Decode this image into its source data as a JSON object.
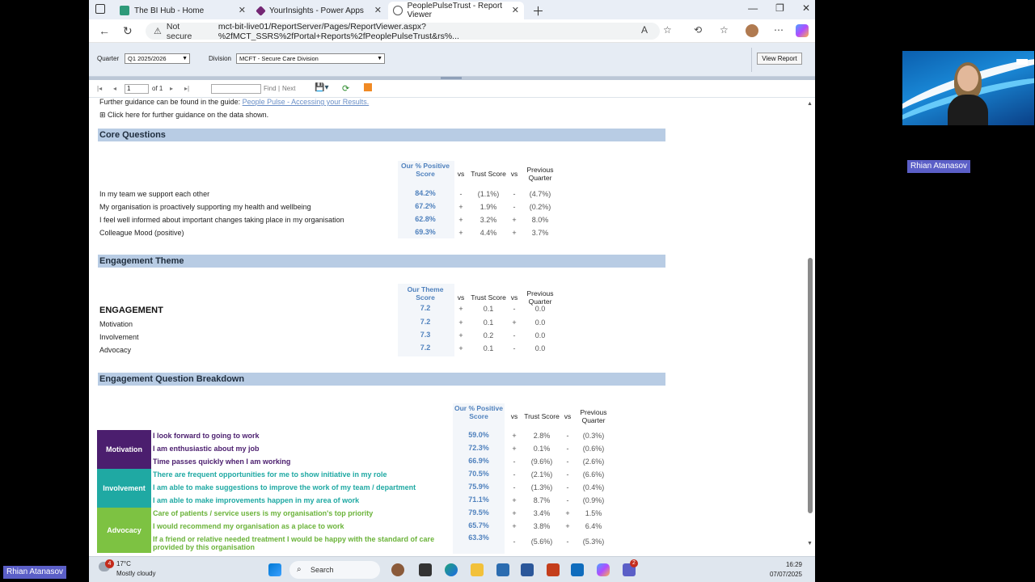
{
  "browser": {
    "tabs": [
      {
        "title": "The BI Hub - Home",
        "icon_color": "#2e9a7a"
      },
      {
        "title": "YourInsights - Power Apps",
        "icon_color": "#742774"
      },
      {
        "title": "PeoplePulseTrust - Report Viewer",
        "icon_color": "#666666"
      }
    ],
    "not_secure": "Not secure",
    "url": "mct-bit-live01/ReportServer/Pages/ReportViewer.aspx?%2fMCT_SSRS%2fPortal+Reports%2fPeoplePulseTrust&rs%..."
  },
  "params": {
    "quarter_label": "Quarter",
    "quarter_value": "Q1 2025/2026",
    "division_label": "Division",
    "division_value": "MCFT - Secure Care Division",
    "view_report": "View Report"
  },
  "toolbar": {
    "page": "1",
    "of": "of 1",
    "find": "Find",
    "sep": "|",
    "next": "Next"
  },
  "report": {
    "guidance_text": "Further guidance can be found in the guide:",
    "guidance_link": "People Pulse - Accessing your Results.",
    "expand_text": "⊞ Click here for further guidance on the data shown.",
    "core": {
      "title": "Core Questions",
      "hdr_score": "Our % Positive Score",
      "hdr_vs": "vs",
      "hdr_trust": "Trust Score",
      "hdr_prev": "Previous Quarter",
      "rows": [
        {
          "q": "In my team we support each other",
          "score": "84.2%",
          "s1": "-",
          "trust": "(1.1%)",
          "s2": "-",
          "prev": "(4.7%)"
        },
        {
          "q": "My organisation is proactively supporting my health and wellbeing",
          "score": "67.2%",
          "s1": "+",
          "trust": "1.9%",
          "s2": "-",
          "prev": "(0.2%)"
        },
        {
          "q": "I feel well informed about important changes taking place in my organisation",
          "score": "62.8%",
          "s1": "+",
          "trust": "3.2%",
          "s2": "+",
          "prev": "8.0%"
        },
        {
          "q": "Colleague Mood (positive)",
          "score": "69.3%",
          "s1": "+",
          "trust": "4.4%",
          "s2": "+",
          "prev": "3.7%"
        }
      ]
    },
    "engagement": {
      "title": "Engagement Theme",
      "hdr_score": "Our Theme Score",
      "hdr_vs": "vs",
      "hdr_trust": "Trust Score",
      "hdr_prev": "Previous Quarter",
      "rows": [
        {
          "q": "ENGAGEMENT",
          "score": "7.2",
          "s1": "+",
          "trust": "0.1",
          "s2": "-",
          "prev": "0.0",
          "bold": true
        },
        {
          "q": "Motivation",
          "score": "7.2",
          "s1": "+",
          "trust": "0.1",
          "s2": "+",
          "prev": "0.0"
        },
        {
          "q": "Involvement",
          "score": "7.3",
          "s1": "+",
          "trust": "0.2",
          "s2": "-",
          "prev": "0.0"
        },
        {
          "q": "Advocacy",
          "score": "7.2",
          "s1": "+",
          "trust": "0.1",
          "s2": "-",
          "prev": "0.0"
        }
      ]
    },
    "breakdown": {
      "title": "Engagement Question Breakdown",
      "hdr_score": "Our % Positive Score",
      "hdr_vs": "vs",
      "hdr_trust": "Trust Score",
      "hdr_prev": "Previous Quarter",
      "groups": [
        {
          "name": "Motivation",
          "color": "#4b1e6e",
          "text_color": "#4b1e6e",
          "rows": [
            {
              "q": "I look forward to going to work",
              "score": "59.0%",
              "s1": "+",
              "trust": "2.8%",
              "s2": "-",
              "prev": "(0.3%)"
            },
            {
              "q": "I am enthusiastic about my job",
              "score": "72.3%",
              "s1": "+",
              "trust": "0.1%",
              "s2": "-",
              "prev": "(0.6%)"
            },
            {
              "q": "Time passes quickly when I am working",
              "score": "66.9%",
              "s1": "-",
              "trust": "(9.6%)",
              "s2": "-",
              "prev": "(2.6%)"
            }
          ]
        },
        {
          "name": "Involvement",
          "color": "#1fa9a3",
          "text_color": "#1fa9a3",
          "rows": [
            {
              "q": "There are frequent opportunities for me to show initiative in my role",
              "score": "70.5%",
              "s1": "-",
              "trust": "(2.1%)",
              "s2": "-",
              "prev": "(6.6%)"
            },
            {
              "q": "I am able to make suggestions to improve the work of my team / department",
              "score": "75.9%",
              "s1": "-",
              "trust": "(1.3%)",
              "s2": "-",
              "prev": "(0.4%)"
            },
            {
              "q": "I am able to make improvements happen in my area of work",
              "score": "71.1%",
              "s1": "+",
              "trust": "8.7%",
              "s2": "-",
              "prev": "(0.9%)"
            }
          ]
        },
        {
          "name": "Advocacy",
          "color": "#7dc242",
          "text_color": "#6bb33a",
          "rows": [
            {
              "q": "Care of patients / service users is my organisation's top priority",
              "score": "79.5%",
              "s1": "+",
              "trust": "3.4%",
              "s2": "+",
              "prev": "1.5%"
            },
            {
              "q": "I would recommend my organisation as a place to work",
              "score": "65.7%",
              "s1": "+",
              "trust": "3.8%",
              "s2": "+",
              "prev": "6.4%"
            },
            {
              "q": "If a friend or relative needed treatment I would be happy with the standard of care provided by this organisation",
              "score": "63.3%",
              "s1": "-",
              "trust": "(5.6%)",
              "s2": "-",
              "prev": "(5.3%)"
            }
          ]
        }
      ]
    }
  },
  "meeting": {
    "participant": "Rhian Atanasov",
    "self_name": "Rhian Atanasov"
  },
  "taskbar": {
    "weather_badge": "4",
    "temperature": "17°C",
    "weather": "Mostly cloudy",
    "search": "Search",
    "teams_badge": "2",
    "time": "16:29",
    "date": "07/07/2025"
  }
}
